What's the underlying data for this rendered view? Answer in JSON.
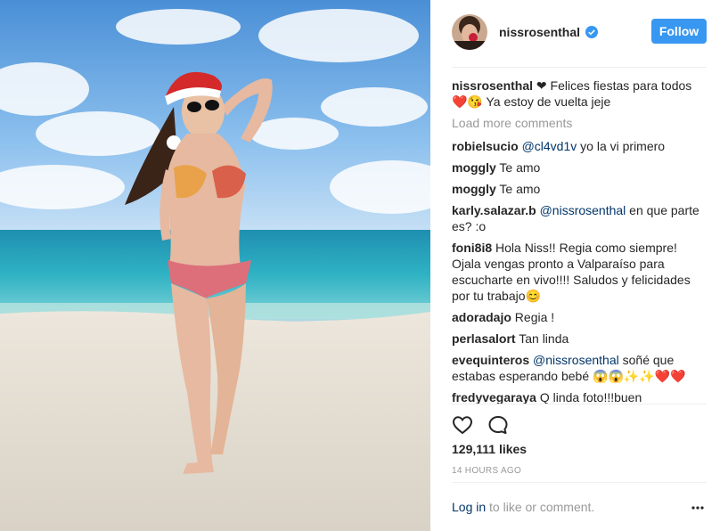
{
  "post": {
    "author": "nissrosenthal",
    "follow_label": "Follow",
    "caption": {
      "user": "nissrosenthal",
      "text": "❤ Felices fiestas para todos ❤️😘 Ya estoy de vuelta jeje"
    },
    "load_more_label": "Load more comments",
    "comments": [
      {
        "user": "robielsucio",
        "mention": "@cl4vd1v",
        "text": " yo la vi primero"
      },
      {
        "user": "moggly",
        "mention": "",
        "text": "Te amo"
      },
      {
        "user": "moggly",
        "mention": "",
        "text": "Te amo"
      },
      {
        "user": "karly.salazar.b",
        "mention": "@nissrosenthal",
        "text": " en que parte es? :o"
      },
      {
        "user": "foni8i8",
        "mention": "",
        "text": "Hola Niss!! Regia como siempre! Ojala vengas pronto a Valparaíso para escucharte en vivo!!!! Saludos y felicidades por tu trabajo😊"
      },
      {
        "user": "adoradajo",
        "mention": "",
        "text": "Regia !"
      },
      {
        "user": "perlasalort",
        "mention": "",
        "text": "Tan linda"
      },
      {
        "user": "evequinteros",
        "mention": "@nissrosenthal",
        "text": " soñé que estabas esperando bebé 😱😱✨✨❤️❤️"
      },
      {
        "user": "fredyvegaraya",
        "mention": "",
        "text": "Q linda foto!!!buen"
      }
    ],
    "likes_label": "129,111 likes",
    "timestamp": "14 HOURS AGO",
    "login_link": "Log in",
    "login_rest": " to like or comment.",
    "icons": {
      "verified": "verified-badge-icon",
      "like": "heart-icon",
      "comment": "comment-bubble-icon",
      "more": "more-options-icon"
    },
    "colors": {
      "follow_button": "#3897f0",
      "link": "#003569",
      "muted": "#999999"
    }
  }
}
